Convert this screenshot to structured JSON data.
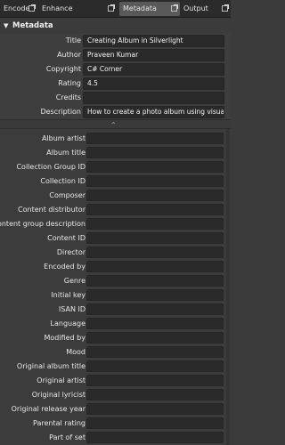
{
  "tabs": [
    {
      "label": "Encode"
    },
    {
      "label": "Enhance"
    },
    {
      "label": "Metadata"
    },
    {
      "label": "Output"
    }
  ],
  "section": {
    "title": "Metadata",
    "collapse_icon": "triangle-down-icon"
  },
  "fields": [
    {
      "label": "Title",
      "value": "Creating Album in Silverlight"
    },
    {
      "label": "Author",
      "value": "Praveen Kumar"
    },
    {
      "label": "Copyright",
      "value": "C# Corner"
    },
    {
      "label": "Rating",
      "value": "4.5"
    },
    {
      "label": "Credits",
      "value": ""
    },
    {
      "label": "Description",
      "value": "How to create a photo album using visual st..."
    }
  ],
  "divider": {
    "icon": "chevron-up-icon"
  },
  "extra_fields": [
    {
      "label": "Album artist",
      "value": ""
    },
    {
      "label": "Album title",
      "value": ""
    },
    {
      "label": "Collection Group ID",
      "value": ""
    },
    {
      "label": "Collection ID",
      "value": ""
    },
    {
      "label": "Composer",
      "value": ""
    },
    {
      "label": "Content distributor",
      "value": ""
    },
    {
      "label": "Content group description",
      "value": ""
    },
    {
      "label": "Content ID",
      "value": ""
    },
    {
      "label": "Director",
      "value": ""
    },
    {
      "label": "Encoded by",
      "value": ""
    },
    {
      "label": "Genre",
      "value": ""
    },
    {
      "label": "Initial key",
      "value": ""
    },
    {
      "label": "ISAN ID",
      "value": ""
    },
    {
      "label": "Language",
      "value": ""
    },
    {
      "label": "Modified by",
      "value": ""
    },
    {
      "label": "Mood",
      "value": ""
    },
    {
      "label": "Original album title",
      "value": ""
    },
    {
      "label": "Original artist",
      "value": ""
    },
    {
      "label": "Original lyricist",
      "value": ""
    },
    {
      "label": "Original release year",
      "value": ""
    },
    {
      "label": "Parental rating",
      "value": ""
    },
    {
      "label": "Part of set",
      "value": ""
    }
  ]
}
